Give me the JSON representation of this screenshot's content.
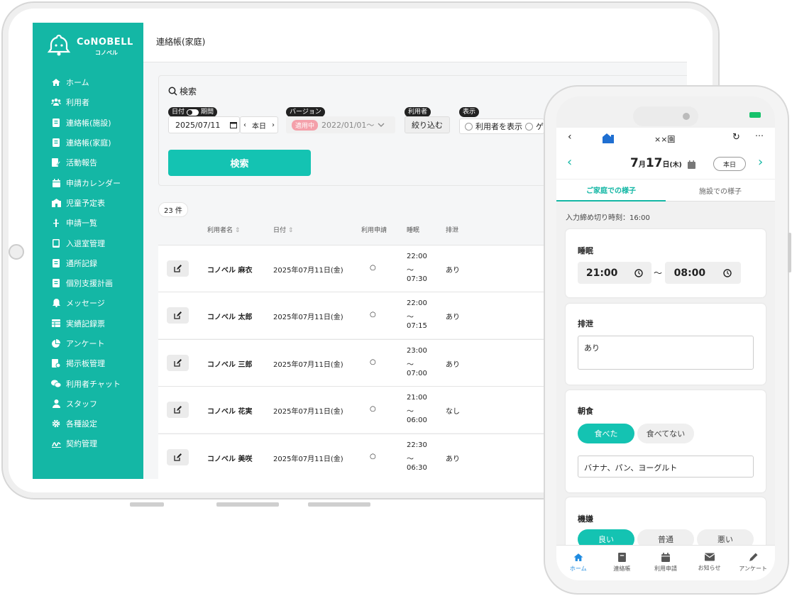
{
  "logo": {
    "brand": "CoNOBELL",
    "sub": "コノベル"
  },
  "sidebar": {
    "items": [
      {
        "label": "ホーム",
        "icon": "home-icon"
      },
      {
        "label": "利用者",
        "icon": "users-icon"
      },
      {
        "label": "連絡帳(施設)",
        "icon": "book-icon"
      },
      {
        "label": "連絡帳(家庭)",
        "icon": "book-icon"
      },
      {
        "label": "活動報告",
        "icon": "pencil-doc-icon"
      },
      {
        "label": "申請カレンダー",
        "icon": "calendar-icon"
      },
      {
        "label": "児童予定表",
        "icon": "schedule-icon"
      },
      {
        "label": "申請一覧",
        "icon": "list-icon"
      },
      {
        "label": "入退室管理",
        "icon": "tablet-icon"
      },
      {
        "label": "通所記録",
        "icon": "record-icon"
      },
      {
        "label": "個別支援計画",
        "icon": "plan-icon"
      },
      {
        "label": "メッセージ",
        "icon": "bell-icon"
      },
      {
        "label": "実績記録票",
        "icon": "table-icon"
      },
      {
        "label": "アンケート",
        "icon": "pie-icon"
      },
      {
        "label": "掲示板管理",
        "icon": "board-icon"
      },
      {
        "label": "利用者チャット",
        "icon": "chat-icon"
      },
      {
        "label": "スタッフ",
        "icon": "staff-icon"
      },
      {
        "label": "各種設定",
        "icon": "gear-icon"
      },
      {
        "label": "契約管理",
        "icon": "contract-icon"
      }
    ]
  },
  "header": {
    "title": "連絡帳(家庭)"
  },
  "search": {
    "title": "検索",
    "date_tag": "日付",
    "period_label": "期間",
    "date_value": "2025/07/11",
    "today": "本日",
    "version_tag": "バージョン",
    "version_badge": "適用中",
    "version_value": "2022/01/01〜",
    "user_tag": "利用者",
    "narrow": "絞り込む",
    "display_tag": "表示",
    "show_users": "利用者を表示",
    "other": "ゲ",
    "button": "検索"
  },
  "count": "23 件",
  "table": {
    "headers": {
      "name": "利用者名",
      "date": "日付",
      "application": "利用申請",
      "sleep": "睡眠",
      "excretion": "排泄"
    },
    "rows": [
      {
        "name": "コノベル 麻衣",
        "date": "2025年07月11日(金)",
        "app": "○",
        "s1": "22:00",
        "sep": "〜",
        "s2": "07:30",
        "ex": "あり"
      },
      {
        "name": "コノベル 太郎",
        "date": "2025年07月11日(金)",
        "app": "○",
        "s1": "22:00",
        "sep": "〜",
        "s2": "07:15",
        "ex": "あり"
      },
      {
        "name": "コノベル 三郎",
        "date": "2025年07月11日(金)",
        "app": "○",
        "s1": "23:00",
        "sep": "〜",
        "s2": "07:00",
        "ex": "あり"
      },
      {
        "name": "コノベル 花実",
        "date": "2025年07月11日(金)",
        "app": "○",
        "s1": "21:00",
        "sep": "〜",
        "s2": "06:00",
        "ex": "なし"
      },
      {
        "name": "コノベル 美咲",
        "date": "2025年07月11日(金)",
        "app": "○",
        "s1": "22:30",
        "sep": "〜",
        "s2": "06:30",
        "ex": "あり"
      }
    ]
  },
  "phone": {
    "facility": "××園",
    "month": "7",
    "month_unit": "月",
    "day": "17",
    "day_unit": "日",
    "weekday": "(木)",
    "today": "本日",
    "tab_home": "ご家庭での様子",
    "tab_facility": "施設での様子",
    "deadline": "入力締め切り時刻：16:00",
    "sleep": {
      "title": "睡眠",
      "from": "21:00",
      "sep": "〜",
      "to": "08:00"
    },
    "excretion": {
      "title": "排泄",
      "value": "あり"
    },
    "breakfast": {
      "title": "朝食",
      "ate": "食べた",
      "not_ate": "食べてない",
      "menu": "バナナ、パン、ヨーグルト"
    },
    "mood": {
      "title": "機嫌",
      "good": "良い",
      "normal": "普通",
      "bad": "悪い"
    },
    "tabbar": [
      "ホーム",
      "連絡帳",
      "利用申請",
      "お知らせ",
      "アンケート"
    ]
  },
  "colors": {
    "accent": "#14b7a5",
    "accent_light": "#14c3b2"
  }
}
